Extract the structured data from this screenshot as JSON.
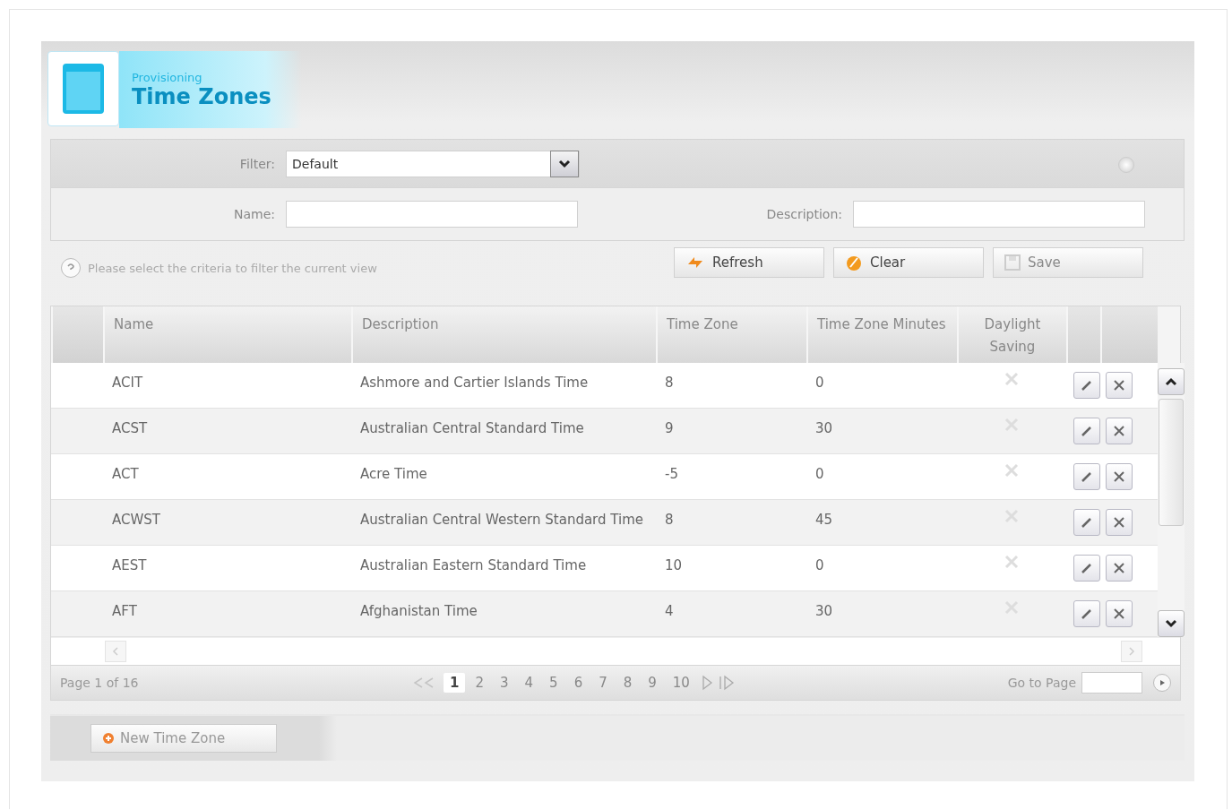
{
  "header": {
    "section": "Provisioning",
    "title": "Time Zones"
  },
  "filter": {
    "label": "Filter:",
    "value": "Default",
    "name_label": "Name:",
    "description_label": "Description:"
  },
  "hint": "Please select the criteria to filter the current view",
  "actions": [
    {
      "label": "Refresh",
      "kind": "refresh",
      "disabled": false
    },
    {
      "label": "Clear",
      "kind": "clear",
      "disabled": false
    },
    {
      "label": "Save",
      "kind": "save",
      "disabled": true
    }
  ],
  "table": {
    "columns": [
      "Name",
      "Description",
      "Time Zone",
      "Time Zone Minutes",
      "Daylight Saving"
    ],
    "rows": [
      {
        "name": "ACIT",
        "description": "Ashmore and Cartier Islands Time",
        "time_zone": "8",
        "minutes": "0",
        "daylight_saving": false
      },
      {
        "name": "ACST",
        "description": "Australian Central Standard Time",
        "time_zone": "9",
        "minutes": "30",
        "daylight_saving": false
      },
      {
        "name": "ACT",
        "description": "Acre Time",
        "time_zone": "-5",
        "minutes": "0",
        "daylight_saving": false
      },
      {
        "name": "ACWST",
        "description": "Australian Central Western Standard Time",
        "time_zone": "8",
        "minutes": "45",
        "daylight_saving": false
      },
      {
        "name": "AEST",
        "description": "Australian Eastern Standard Time",
        "time_zone": "10",
        "minutes": "0",
        "daylight_saving": false
      },
      {
        "name": "AFT",
        "description": "Afghanistan Time",
        "time_zone": "4",
        "minutes": "30",
        "daylight_saving": false
      }
    ]
  },
  "pager": {
    "summary": "Page 1 of 16",
    "pages": [
      {
        "label": "1",
        "selected": true
      },
      {
        "label": "2",
        "selected": false
      },
      {
        "label": "3",
        "selected": false
      },
      {
        "label": "4",
        "selected": false
      },
      {
        "label": "5",
        "selected": false
      },
      {
        "label": "6",
        "selected": false
      },
      {
        "label": "7",
        "selected": false
      },
      {
        "label": "8",
        "selected": false
      },
      {
        "label": "9",
        "selected": false
      },
      {
        "label": "10",
        "selected": false
      }
    ],
    "goto_label": "Go to Page"
  },
  "new_button": "New Time Zone"
}
